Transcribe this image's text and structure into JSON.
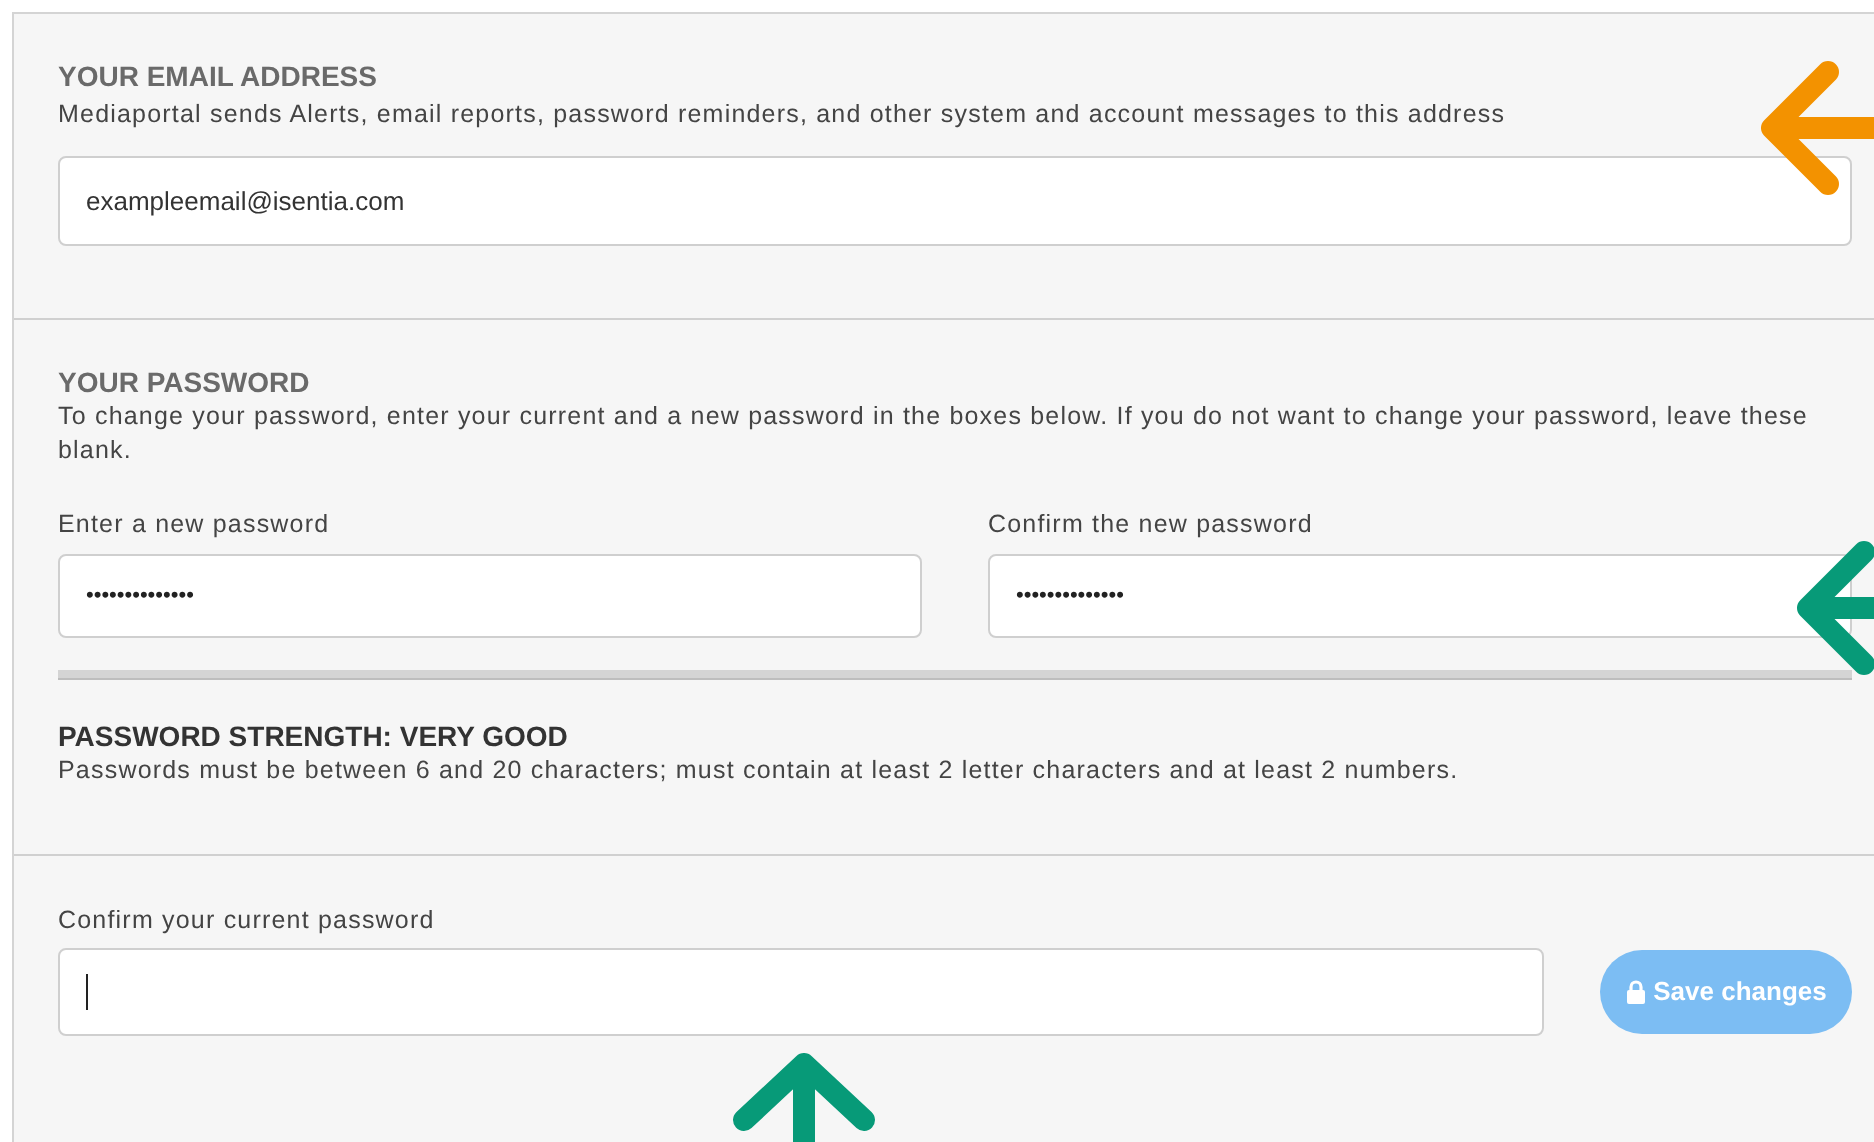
{
  "email_section": {
    "heading": "YOUR EMAIL ADDRESS",
    "description": "Mediaportal sends Alerts, email reports, password reminders, and other system and account messages to this address",
    "email_field": {
      "value": "exampleemail@isentia.com"
    }
  },
  "password_section": {
    "heading": "YOUR PASSWORD",
    "description": "To change your password, enter your current and a new password in the boxes below. If you do not want to change your password, leave these blank.",
    "fields": [
      {
        "label": "Enter a new password",
        "value": "••••••••••••••"
      },
      {
        "label": "Confirm the new password",
        "value": "••••••••••••••"
      }
    ]
  },
  "strength": {
    "heading": "PASSWORD STRENGTH: VERY GOOD",
    "description": "Passwords must be between 6 and 20 characters; must contain at least 2 letter characters and at least 2 numbers."
  },
  "current_password": {
    "label": "Confirm your current password",
    "focused": true
  },
  "save_button": {
    "label": "Save changes",
    "disabled": true
  },
  "annotations": [
    {
      "kind": "left",
      "color": "#f39200"
    },
    {
      "kind": "left",
      "color": "#079a78"
    },
    {
      "kind": "up",
      "color": "#079a78"
    }
  ]
}
